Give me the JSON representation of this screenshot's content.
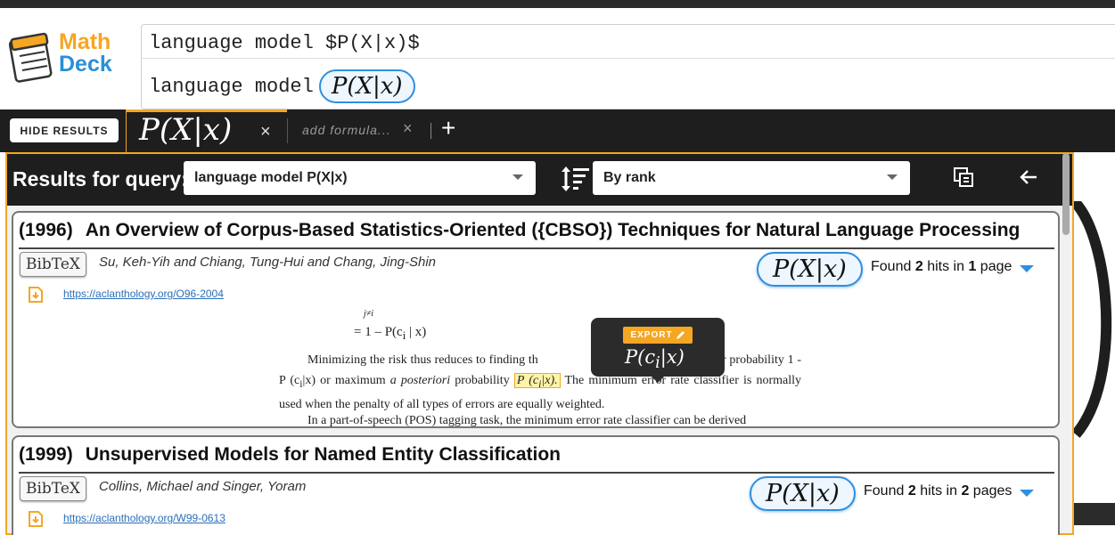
{
  "logo": {
    "line1": "Math",
    "line2": "Deck"
  },
  "query": {
    "raw": "language model $P(X|x)$",
    "rendered_text": "language model",
    "rendered_formula": "P(X|x)"
  },
  "tabs": {
    "hide_results_label": "HIDE RESULTS",
    "active_formula": "P(X|x)",
    "close_glyph": "×",
    "add_formula_label": "add formula...",
    "add_close_glyph": "×",
    "plus_glyph": "+"
  },
  "results": {
    "label": "Results for query:",
    "query_value": "language model P(X|x)",
    "sort_value": "By rank"
  },
  "cards": [
    {
      "year": "(1996)",
      "title": "An Overview of Corpus-Based Statistics-Oriented ({CBSO}) Techniques for Natural Language Processing",
      "bibtex_label": "BibTeX",
      "authors": "Su, Keh-Yih and Chiang, Tung-Hui and Chang, Jing-Shin",
      "url": "https://aclanthology.org/O96-2004",
      "formula": "P(X|x)",
      "hits_prefix": "Found",
      "hits_count": "2",
      "hits_mid": "hits in",
      "pages_count": "1",
      "pages_label": "page"
    },
    {
      "year": "(1999)",
      "title": "Unsupervised Models for Named Entity Classification",
      "bibtex_label": "BibTeX",
      "authors": "Collins, Michael and Singer, Yoram",
      "url": "https://aclanthology.org/W99-0613",
      "formula": "P(X|x)",
      "hits_prefix": "Found",
      "hits_count": "2",
      "hits_mid": "hits in",
      "pages_count": "2",
      "pages_label": "pages"
    }
  ],
  "snippet": {
    "eq_top": "j≠i",
    "eq": "= 1 – P(c",
    "eq_sub": "i",
    "eq_tail": " | x)",
    "p1_a": "Minimizing the risk thus reduces to finding th",
    "p1_b": "minimum error probability 1 - P (c",
    "p1_c": "|x) or maximum",
    "p1_italic": "a posteriori",
    "p1_d": "probability",
    "p1_hl": "P (c",
    "p1_hl_tail": "|x).",
    "p1_e": "The minimum error rate classifier is normally used when the penalty of all types of errors are equally weighted.",
    "p2": "In a part-of-speech (POS) tagging task, the minimum error rate classifier can be derived"
  },
  "tooltip": {
    "export_label": "EXPORT",
    "formula": "P(c_i|x)"
  },
  "colors": {
    "accent": "#f5a623",
    "blue": "#2e8fe0",
    "dark": "#1e1e1e"
  }
}
